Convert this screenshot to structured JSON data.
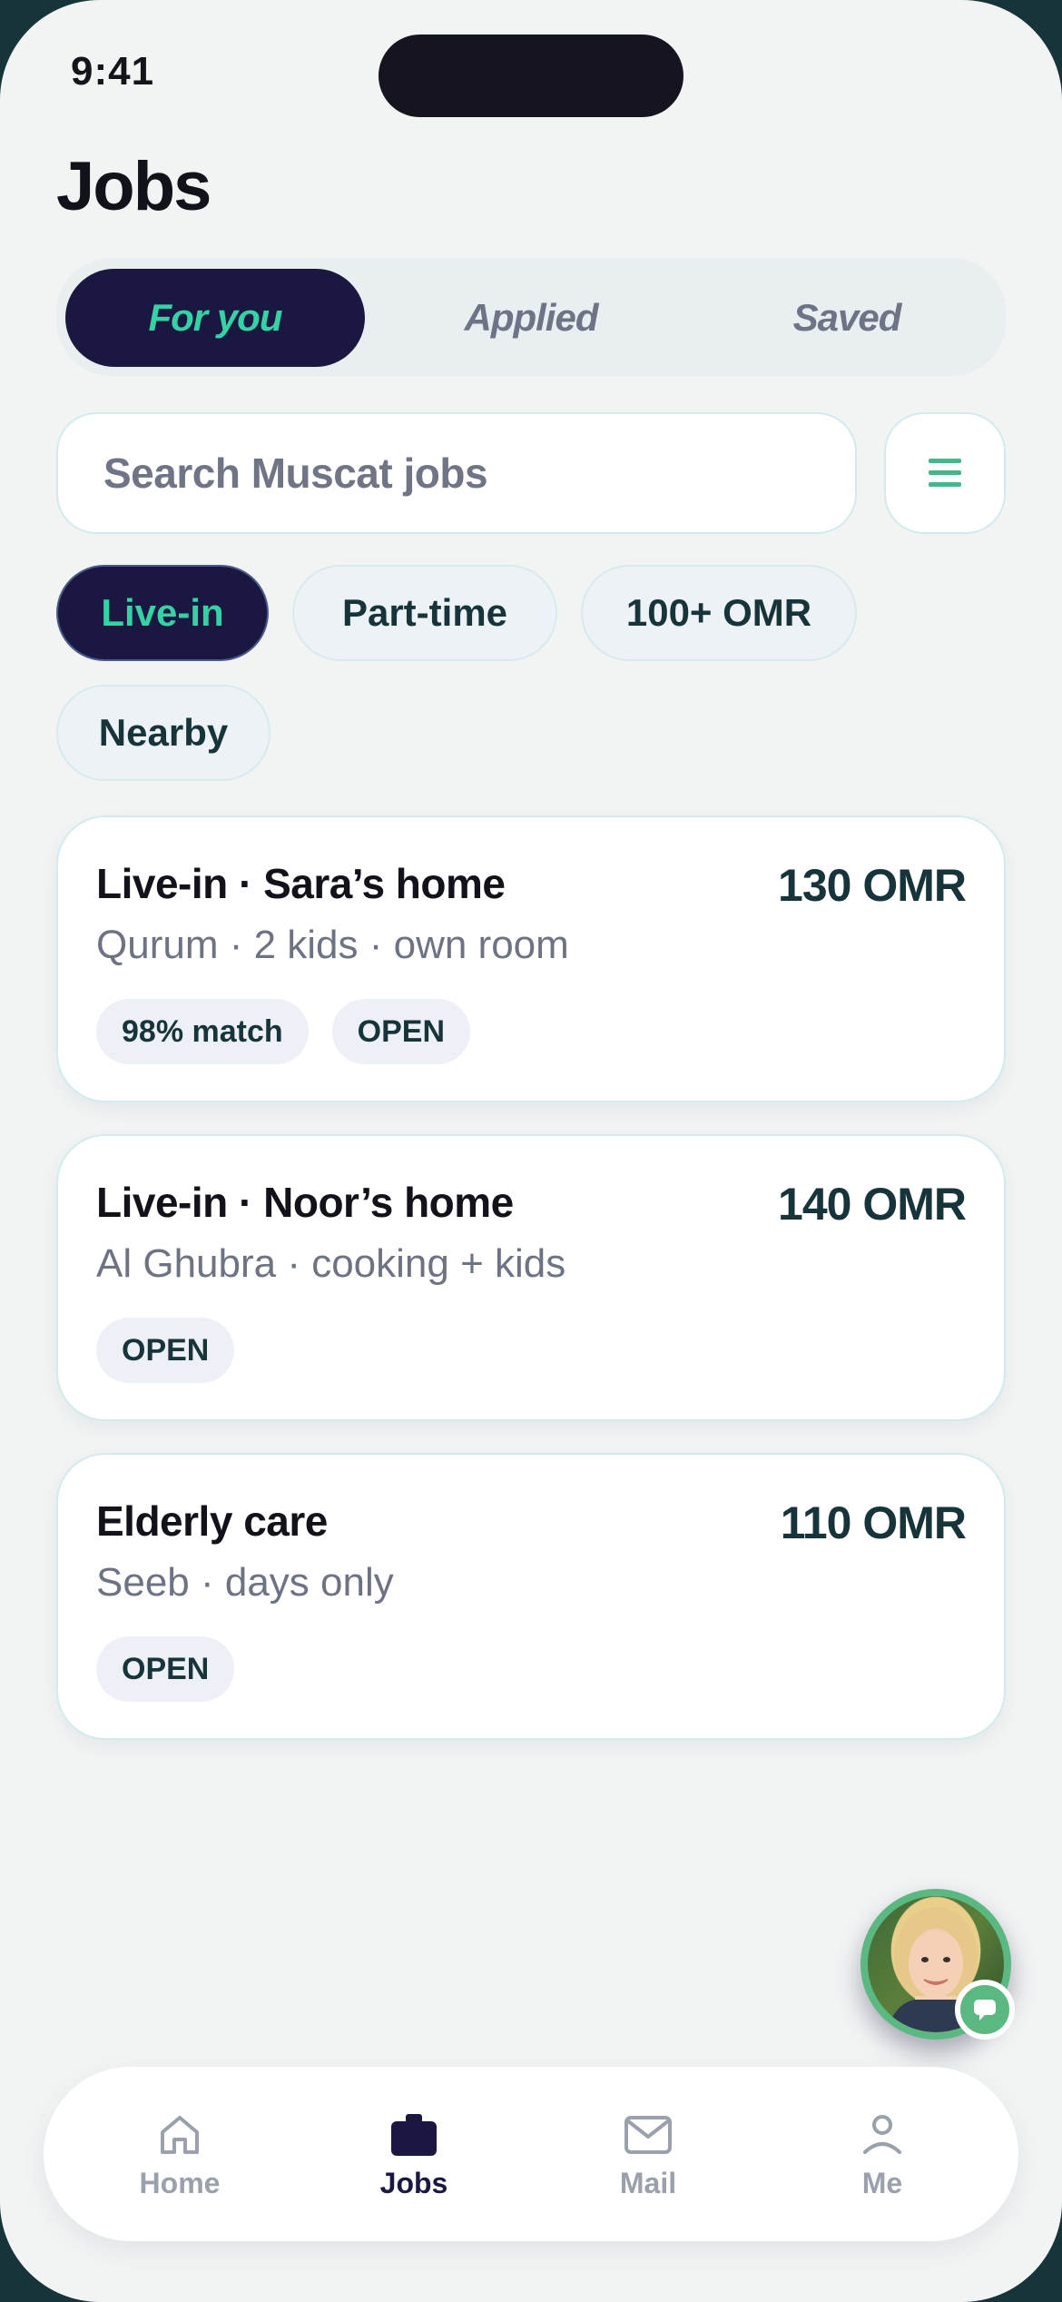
{
  "status_bar": {
    "time": "9:41"
  },
  "page_title": "Jobs",
  "tabs": [
    {
      "label": "For you",
      "active": true
    },
    {
      "label": "Applied",
      "active": false
    },
    {
      "label": "Saved",
      "active": false
    }
  ],
  "search": {
    "placeholder": "Search Muscat jobs",
    "value": ""
  },
  "filter_icon": "menu-lines-icon",
  "chips": [
    {
      "label": "Live-in",
      "active": true
    },
    {
      "label": "Part-time",
      "active": false
    },
    {
      "label": "100+ OMR",
      "active": false
    },
    {
      "label": "Nearby",
      "active": false
    }
  ],
  "jobs": [
    {
      "title": "Live-in · Sara’s home",
      "subtitle": "Qurum · 2 kids · own room",
      "price": "130 OMR",
      "badges": [
        "98% match",
        "OPEN"
      ]
    },
    {
      "title": "Live-in · Noor’s home",
      "subtitle": "Al Ghubra · cooking + kids",
      "price": "140 OMR",
      "badges": [
        "OPEN"
      ]
    },
    {
      "title": "Elderly care",
      "subtitle": "Seeb · days only",
      "price": "110 OMR",
      "badges": [
        "OPEN"
      ]
    }
  ],
  "fab": {
    "icon": "chat-bubble-icon"
  },
  "nav": [
    {
      "label": "Home",
      "icon": "home-icon",
      "active": false
    },
    {
      "label": "Jobs",
      "icon": "briefcase-icon",
      "active": true
    },
    {
      "label": "Mail",
      "icon": "mail-icon",
      "active": false
    },
    {
      "label": "Me",
      "icon": "person-icon",
      "active": false
    }
  ],
  "colors": {
    "accent": "#35d2a5",
    "navy": "#1a1840",
    "background": "#f2f4f4",
    "muted": "#6e7486",
    "green": "#5bb881"
  }
}
